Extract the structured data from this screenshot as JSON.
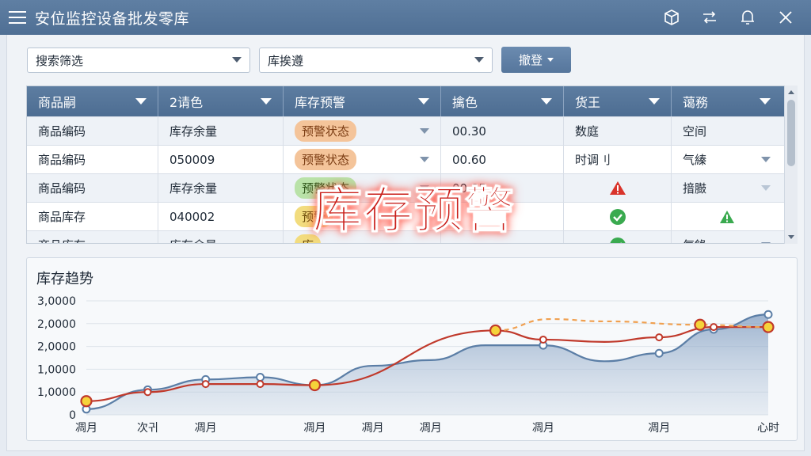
{
  "app": {
    "title": "安位监控设备批发零库"
  },
  "toolbar": {
    "icons": [
      "menu-icon",
      "cube-icon",
      "swap-icon",
      "bell-icon",
      "close-icon"
    ]
  },
  "filters": {
    "search_value": "搜索筛选",
    "category_value": "库挨遵",
    "action_label": "撤登"
  },
  "table": {
    "headers": [
      "商品嗣",
      "2请色",
      "库存预警",
      "擒色",
      "货王",
      "蔼務"
    ],
    "rows": [
      {
        "c1": "商品编码",
        "c2": "库存余量",
        "status": "预警状态",
        "status_color": "orange",
        "c4": "00.30",
        "c5": "数庭",
        "c6": "空间",
        "c5_icon": "",
        "c6_icon": ""
      },
      {
        "c1": "商品编码",
        "c2": "050009",
        "status": "预警状态",
        "status_color": "orange",
        "c4": "00.60",
        "c5": "时调刂",
        "c6": "气縥",
        "c5_icon": "",
        "c6_icon": ""
      },
      {
        "c1": "商品编码",
        "c2": "库存余量",
        "status": "预警状态",
        "status_color": "green",
        "c4": "00.05",
        "c5": "",
        "c6": "揞臌",
        "c5_icon": "alert-icon",
        "c6_icon": ""
      },
      {
        "c1": "商品库存",
        "c2": "040002",
        "status": "预警",
        "status_color": "yellow",
        "c4": "",
        "c5": "",
        "c6": "",
        "c5_icon": "check-icon",
        "c6_icon": "warning-icon"
      },
      {
        "c1": "商品库存",
        "c2": "库存余量",
        "status": "库",
        "status_color": "yellow",
        "c4": "",
        "c5": "",
        "c6": "气錄",
        "c5_icon": "check-icon",
        "c6_icon": ""
      }
    ]
  },
  "overlay": {
    "text": "库存预警"
  },
  "colors": {
    "header": "#5d7da1",
    "blue_line": "#5b7ea6",
    "red_line": "#c0392b",
    "marker_yellow": "#f5d33a",
    "dashed": "#f0a050"
  },
  "chart_data": {
    "type": "line",
    "title": "库存趋势",
    "ylabels": [
      "3,0000",
      "2,0000",
      "2,0000",
      "1,0000",
      "1,0000",
      "0"
    ],
    "xlabels": [
      "凋月",
      "次귀",
      "凋月",
      "凋月",
      "凋月",
      "凋月",
      "凋月",
      "凋月",
      "心时"
    ],
    "x_range": [
      0,
      1
    ],
    "y_range": [
      0,
      5
    ],
    "series": [
      {
        "kind": "area",
        "points": [
          [
            0,
            0.25
          ],
          [
            0.09,
            1.1
          ],
          [
            0.175,
            1.55
          ],
          [
            0.255,
            1.65
          ],
          [
            0.335,
            1.3
          ],
          [
            0.42,
            2.15
          ],
          [
            0.505,
            2.4
          ],
          [
            0.585,
            3.05
          ],
          [
            0.67,
            3.05
          ],
          [
            0.76,
            2.35
          ],
          [
            0.84,
            2.7
          ],
          [
            0.92,
            3.75
          ],
          [
            1,
            4.4
          ]
        ],
        "markers": [
          0,
          1,
          2,
          3,
          8,
          10,
          11,
          12
        ]
      },
      {
        "kind": "line",
        "points": [
          [
            0,
            0.6
          ],
          [
            0.09,
            1.0
          ],
          [
            0.175,
            1.35
          ],
          [
            0.255,
            1.35
          ],
          [
            0.335,
            1.3
          ],
          [
            0.6,
            3.7
          ],
          [
            0.67,
            3.3
          ],
          [
            0.76,
            3.2
          ],
          [
            0.84,
            3.4
          ],
          [
            0.92,
            3.85
          ],
          [
            1,
            3.85
          ]
        ],
        "markers": [
          0,
          1,
          2,
          3,
          4,
          5,
          6,
          8,
          9,
          10
        ]
      },
      {
        "kind": "dashed",
        "points": [
          [
            0.6,
            3.7
          ],
          [
            0.68,
            4.2
          ],
          [
            0.76,
            4.1
          ],
          [
            0.9,
            3.95
          ],
          [
            1,
            3.85
          ]
        ]
      }
    ],
    "highlight_points": [
      [
        0,
        0.6
      ],
      [
        0.335,
        1.3
      ],
      [
        0.6,
        3.7
      ],
      [
        0.9,
        3.95
      ],
      [
        1,
        3.85
      ]
    ]
  }
}
